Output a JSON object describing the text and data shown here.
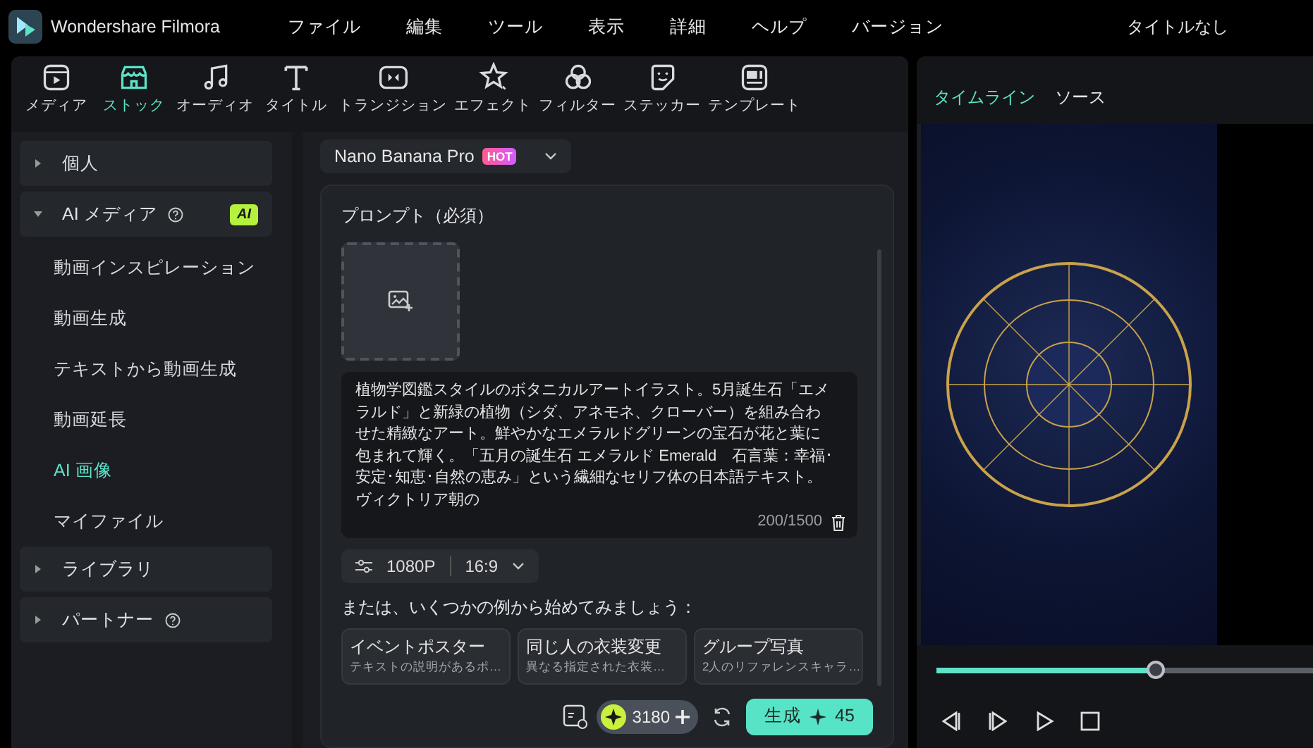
{
  "app": {
    "title": "Wondershare Filmora"
  },
  "menu": [
    "ファイル",
    "編集",
    "ツール",
    "表示",
    "詳細",
    "ヘルプ",
    "バージョン"
  ],
  "document_title": "タイトルなし",
  "toolbar": [
    {
      "label": "メディア",
      "selected": false
    },
    {
      "label": "ストック",
      "selected": true
    },
    {
      "label": "オーディオ",
      "selected": false
    },
    {
      "label": "タイトル",
      "selected": false
    },
    {
      "label": "トランジション",
      "selected": false
    },
    {
      "label": "エフェクト",
      "selected": false
    },
    {
      "label": "フィルター",
      "selected": false
    },
    {
      "label": "ステッカー",
      "selected": false
    },
    {
      "label": "テンプレート",
      "selected": false
    }
  ],
  "sidebar": [
    {
      "label": "個人",
      "expanded": false,
      "help": false
    },
    {
      "label": "AI メディア",
      "expanded": true,
      "help": true,
      "badge": "AI",
      "children": [
        {
          "label": "動画インスピレーション",
          "selected": false
        },
        {
          "label": "動画生成",
          "selected": false
        },
        {
          "label": "テキストから動画生成",
          "selected": false
        },
        {
          "label": "動画延長",
          "selected": false
        },
        {
          "label": "AI 画像",
          "selected": true
        },
        {
          "label": "マイファイル",
          "selected": false
        }
      ]
    },
    {
      "label": "ライブラリ",
      "expanded": false,
      "help": false
    },
    {
      "label": "パートナー",
      "expanded": false,
      "help": true
    }
  ],
  "model_selector": {
    "label": "Nano Banana Pro",
    "badge": "HOT"
  },
  "prompt": {
    "label": "プロンプト（必須）",
    "text": "植物学図鑑スタイルのボタニカルアートイラスト。5月誕生石「エメラルド」と新緑の植物（シダ、アネモネ、クローバー）を組み合わせた精緻なアート。鮮やかなエメラルドグリーンの宝石が花と葉に包まれて輝く。「五月の誕生石 エメラルド Emerald　石言葉：幸福･安定･知恵･自然の恵み」という繊細なセリフ体の日本語テキスト。ヴィクトリア朝の",
    "count": "200/1500"
  },
  "settings": {
    "resolution": "1080P",
    "ratio": "16:9"
  },
  "examples_hint": "または、いくつかの例から始めてみましょう：",
  "examples": [
    {
      "title": "イベントポスター",
      "description": "テキストの説明があるポ…"
    },
    {
      "title": "同じ人の衣装変更",
      "description": "異なる指定された衣装…"
    },
    {
      "title": "グループ写真",
      "description": "2人のリファレンスキャラ…"
    }
  ],
  "credits": "3180",
  "generate": {
    "label": "生成",
    "cost": "45"
  },
  "preview": {
    "tabs": [
      {
        "label": "タイムライン",
        "selected": true
      },
      {
        "label": "ソース",
        "selected": false
      }
    ],
    "level": 0.58
  }
}
